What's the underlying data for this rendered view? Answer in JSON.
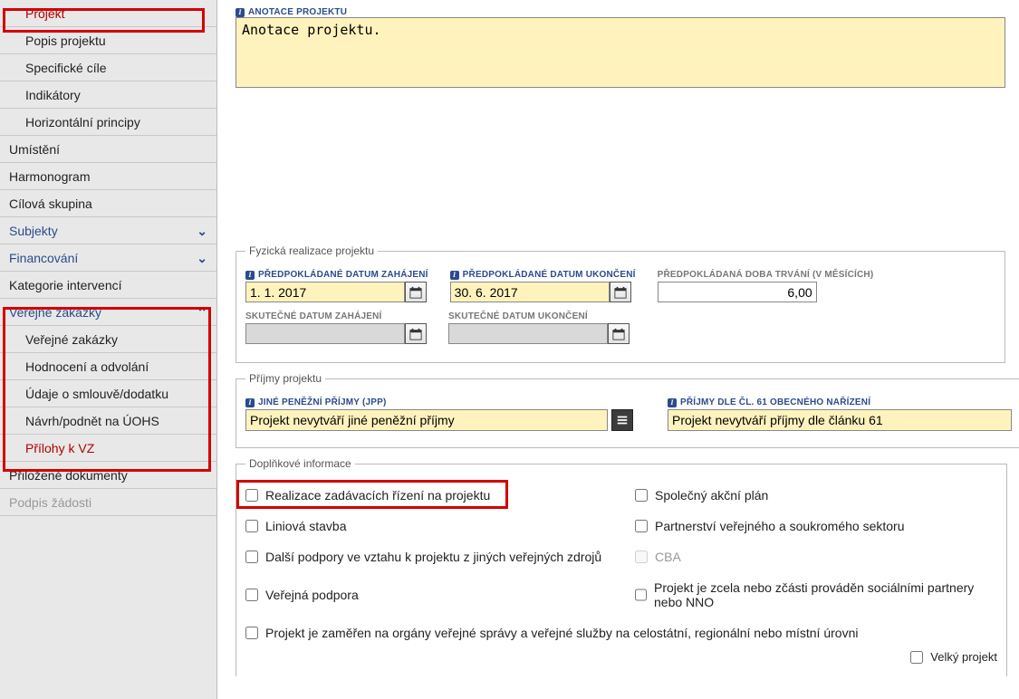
{
  "sidebar": {
    "items": [
      {
        "label": "Projekt",
        "sub": true,
        "cls": "red-text"
      },
      {
        "label": "Popis projektu",
        "sub": true
      },
      {
        "label": "Specifické cíle",
        "sub": true
      },
      {
        "label": "Indikátory",
        "sub": true
      },
      {
        "label": "Horizontální principy",
        "sub": true
      },
      {
        "label": "Umístění"
      },
      {
        "label": "Harmonogram"
      },
      {
        "label": "Cílová skupina"
      },
      {
        "label": "Subjekty",
        "cls": "blue",
        "chev": "down"
      },
      {
        "label": "Financování",
        "cls": "blue",
        "chev": "down"
      },
      {
        "label": "Kategorie intervencí"
      },
      {
        "label": "Veřejné zakázky",
        "cls": "blue",
        "chev": "up"
      },
      {
        "label": "Veřejné zakázky",
        "sub": true
      },
      {
        "label": "Hodnocení a odvolání",
        "sub": true
      },
      {
        "label": "Údaje o smlouvě/dodatku",
        "sub": true
      },
      {
        "label": "Návrh/podnět na ÚOHS",
        "sub": true
      },
      {
        "label": "Přílohy k VZ",
        "sub": true,
        "cls": "red-text"
      },
      {
        "label": "Přiložené dokumenty"
      },
      {
        "label": "Podpis žádosti",
        "cls": "disabled"
      }
    ]
  },
  "annotation": {
    "label": "ANOTACE PROJEKTU",
    "value": "Anotace projektu."
  },
  "realization": {
    "legend": "Fyzická realizace projektu",
    "start_label": "PŘEDPOKLÁDANÉ DATUM ZAHÁJENÍ",
    "start_value": "1. 1. 2017",
    "end_label": "PŘEDPOKLÁDANÉ DATUM UKONČENÍ",
    "end_value": "30. 6. 2017",
    "duration_label": "PŘEDPOKLÁDANÁ DOBA TRVÁNÍ (V MĚSÍCÍCH)",
    "duration_value": "6,00",
    "actual_start_label": "SKUTEČNÉ DATUM ZAHÁJENÍ",
    "actual_start_value": "",
    "actual_end_label": "SKUTEČNÉ DATUM UKONČENÍ",
    "actual_end_value": ""
  },
  "income": {
    "legend": "Příjmy projektu",
    "jpp_label": "JINÉ PENĚŽNÍ PŘÍJMY (JPP)",
    "jpp_value": "Projekt nevytváří jiné peněžní příjmy",
    "art61_label": "PŘÍJMY DLE ČL. 61 OBECNÉHO NAŘÍZENÍ",
    "art61_value": "Projekt nevytváří příjmy dle článku 61"
  },
  "additional": {
    "legend": "Doplňkové informace",
    "checks": [
      {
        "label": "Realizace zadávacích řízení na projektu",
        "col": 1
      },
      {
        "label": "Společný akční plán",
        "col": 2
      },
      {
        "label": "Liniová stavba",
        "col": 1
      },
      {
        "label": "Partnerství veřejného a soukromého sektoru",
        "col": 2
      },
      {
        "label": "Další podpory ve vztahu k projektu z jiných veřejných zdrojů",
        "col": 1
      },
      {
        "label": "CBA",
        "col": 2,
        "disabled": true
      },
      {
        "label": "Veřejná podpora",
        "col": 1
      },
      {
        "label": "Projekt je zcela nebo zčásti prováděn sociálními partnery nebo NNO",
        "col": 2
      },
      {
        "label": "Projekt je zaměřen na orgány veřejné správy a veřejné služby na celostátní, regionální nebo místní úrovni",
        "col": 1,
        "wide": true
      },
      {
        "label": "Velký projekt",
        "col": 2
      }
    ]
  }
}
